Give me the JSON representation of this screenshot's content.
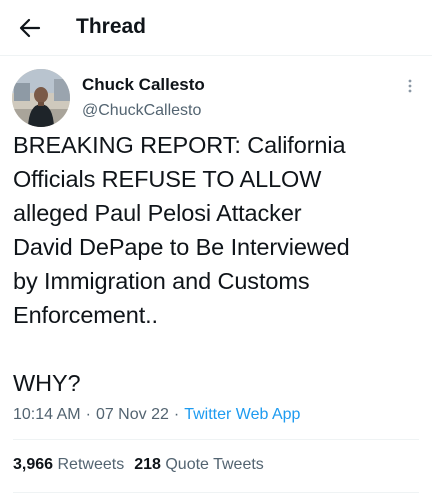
{
  "header": {
    "title": "Thread",
    "back_icon": "arrow-left-icon"
  },
  "author": {
    "display_name": "Chuck Callesto",
    "handle": "@ChuckCallesto",
    "avatar_icon": "profile-photo",
    "more_icon": "more-vertical-icon"
  },
  "tweet": {
    "text": "BREAKING REPORT: California\nOfficials REFUSE TO ALLOW\nalleged Paul Pelosi Attacker\nDavid DePape to Be Interviewed\nby Immigration and Customs\nEnforcement..\n\nWHY?"
  },
  "meta": {
    "time": "10:14 AM",
    "separator": "·",
    "date": "07 Nov 22",
    "source": "Twitter Web App"
  },
  "stats": {
    "retweets_count": "3,966",
    "retweets_label": "Retweets",
    "quotes_count": "218",
    "quotes_label": "Quote Tweets"
  },
  "colors": {
    "text": "#0f1419",
    "secondary": "#536471",
    "link": "#1d9bf0",
    "divider": "#eff3f4"
  }
}
